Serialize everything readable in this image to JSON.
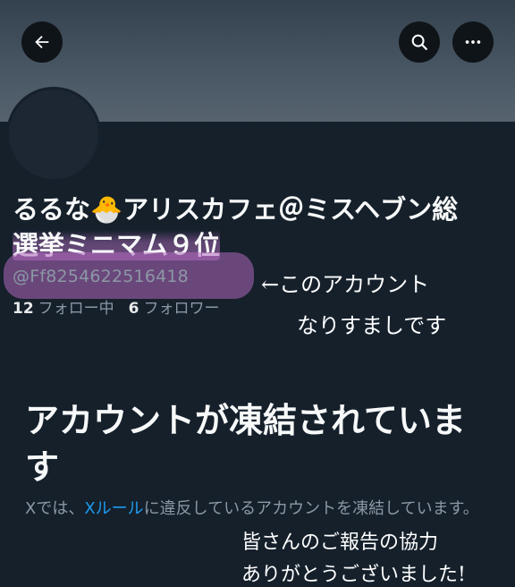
{
  "header": {
    "back_icon": "arrow-left-icon",
    "search_icon": "search-icon",
    "more_icon": "more-horizontal-icon"
  },
  "profile": {
    "display_name_part1": "るるな",
    "display_name_emoji": "🐣",
    "display_name_part2": "アリスカフェ＠ミスヘブン総",
    "display_name_line2": "選挙ミニマム９位",
    "handle": "@Ff8254622516418",
    "following_count": "12",
    "following_label": "フォロー中",
    "followers_count": "6",
    "followers_label": "フォロワー"
  },
  "annotations": {
    "note_line1": "←このアカウント",
    "note_line2": "なりすましです",
    "note_line3": "皆さんのご報告の協力",
    "note_line4": "ありがとうございました!"
  },
  "suspended": {
    "title": "アカウントが凍結されています",
    "text_prefix": "Xでは、",
    "text_link": "Xルール",
    "text_suffix": "に違反しているアカウントを凍結しています。"
  },
  "colors": {
    "background": "#15202b",
    "link": "#1d9bf0",
    "highlight": "#b068be"
  }
}
